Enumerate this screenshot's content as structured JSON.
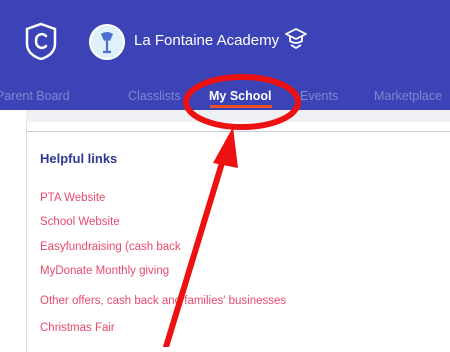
{
  "header": {
    "app_logo_icon": "app-shield-c-icon",
    "school_logo_icon": "school-crest-icon",
    "school_name": "La Fontaine Academy",
    "switch_icon": "graduation-cap-icon",
    "background": "#3b43b6"
  },
  "nav": {
    "tabs": [
      {
        "label": "Parent Board"
      },
      {
        "label": "Classlists"
      },
      {
        "label": "My School",
        "active": true
      },
      {
        "label": "Events"
      },
      {
        "label": "Marketplace"
      }
    ],
    "active_underline_color": "#f04e23"
  },
  "card": {
    "title": "Helpful links",
    "links": [
      {
        "label": "PTA Website"
      },
      {
        "label": "School Website"
      },
      {
        "label": "Easyfundraising (cash back"
      },
      {
        "label": "MyDonate Monthly giving"
      },
      {
        "label": "Other offers, cash back and families' businesses"
      },
      {
        "label": "Christmas Fair"
      }
    ]
  },
  "annotation": {
    "color": "#ee1111",
    "shapes": [
      "circle-highlight",
      "arrow"
    ]
  }
}
